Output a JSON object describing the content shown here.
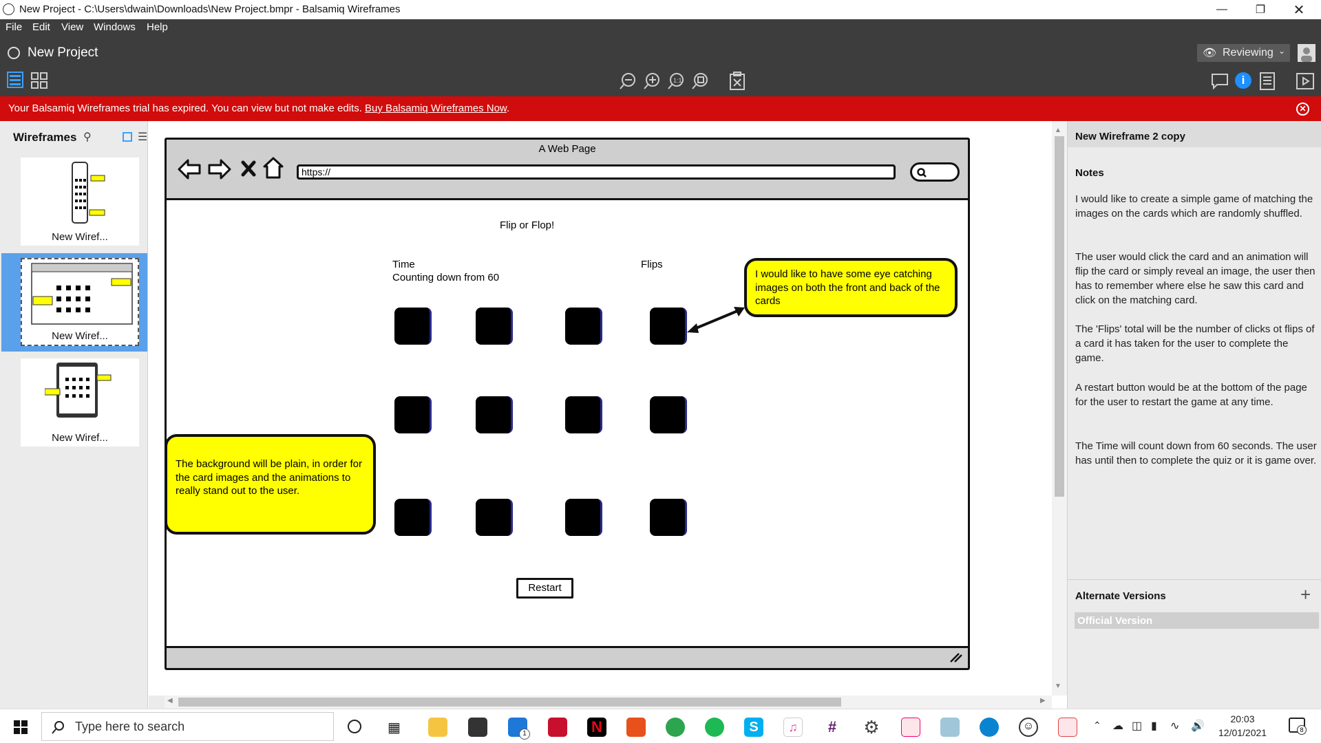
{
  "window": {
    "title": "New Project - C:\\Users\\dwain\\Downloads\\New Project.bmpr - Balsamiq Wireframes"
  },
  "menu": [
    "File",
    "Edit",
    "View",
    "Windows",
    "Help"
  ],
  "project": {
    "name": "New Project",
    "mode": "Reviewing"
  },
  "banner": {
    "message": "Your Balsamiq Wireframes trial has expired. You can view but not make edits. ",
    "link": "Buy Balsamiq Wireframes Now",
    "period": "."
  },
  "sidebar": {
    "title": "Wireframes",
    "thumbnails": [
      {
        "caption": "New Wiref..."
      },
      {
        "caption": "New Wiref..."
      },
      {
        "caption": "New Wiref..."
      }
    ]
  },
  "wireframe": {
    "page_title": "A Web Page",
    "url": "https://",
    "heading": "Flip or Flop!",
    "time_label": "Time",
    "time_sub": "Counting down from 60",
    "flips_label": "Flips",
    "note_top": "I would like to have some eye catching images on both the front and back of the cards",
    "note_left": "The background will be plain, in order for the card images and the animations to really stand out to the user.",
    "restart": "Restart"
  },
  "panel": {
    "title": "New Wireframe 2 copy",
    "notes_header": "Notes",
    "notes": [
      "I would like to create a simple game of matching the images on the cards which are randomly shuffled.",
      "The user would click the card and an animation will flip the card or simply reveal an image, the user then has to remember where else he saw this card and click on the matching card.",
      "The 'Flips' total will be the number of clicks ot flips of a card it has taken for the user to complete the game.",
      "A restart button would be at the bottom of the page for the user to restart the game at any time.",
      "The Time will count down from 60 seconds. The user has until then to complete the quiz or it is game over."
    ],
    "alt_header": "Alternate Versions",
    "official": "Official Version"
  },
  "taskbar": {
    "search_placeholder": "Type here to search",
    "time": "20:03",
    "date": "12/01/2021",
    "mail_badge": "1",
    "notif_badge": "8"
  },
  "colors": {
    "banner": "#d10c0c",
    "note": "#ffff00",
    "toolbar": "#3d3d3d",
    "selected_thumb": "#5aa0ea",
    "info_icon": "#1e90ff"
  }
}
